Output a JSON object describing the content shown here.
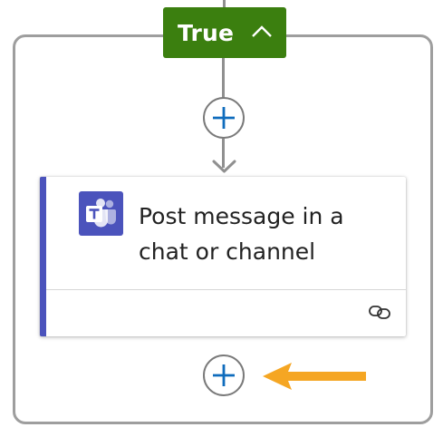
{
  "condition_branch": {
    "label": "True",
    "collapse_icon": "chevron-up-icon",
    "header_color": "#3b7f0f"
  },
  "action_card": {
    "title": "Post message in a chat or channel",
    "icon": "microsoft-teams-icon",
    "accent_color": "#4b53bc",
    "footer_icon": "link-icon"
  },
  "add_step_icon": "plus-icon",
  "add_step_color": "#0f6cbd",
  "highlight_arrow_icon": "orange-arrow-icon",
  "highlight_arrow_color": "#f5a623"
}
